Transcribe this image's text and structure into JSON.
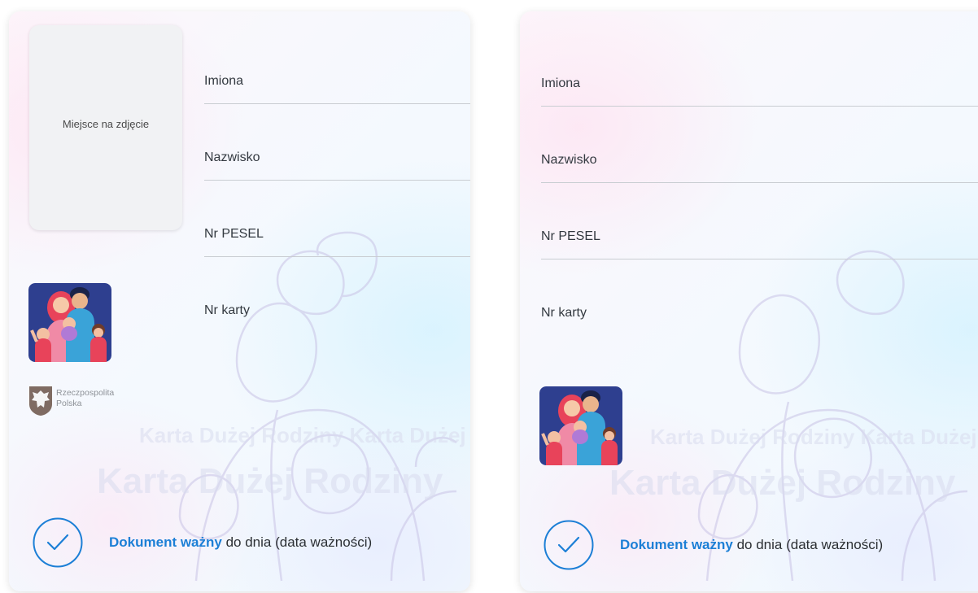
{
  "colors": {
    "accent": "#1c7fd6",
    "field_line": "#c9cdd2",
    "photo_bg": "#f1f2f4"
  },
  "card_left": {
    "photo_placeholder": "Miejsce na zdjęcie",
    "fields": [
      {
        "label": "Imiona"
      },
      {
        "label": "Nazwisko"
      },
      {
        "label": "Nr PESEL"
      },
      {
        "label": "Nr karty"
      }
    ],
    "emblem": {
      "line1": "Rzeczpospolita",
      "line2": "Polska"
    },
    "watermark": {
      "line1": "Karta Dużej Rodziny Karta Dużej",
      "line2": "Karta Dużej Rodziny"
    },
    "validity": {
      "strong": "Dokument ważny",
      "rest": "do dnia (data ważności)",
      "icon": "check-circle-icon"
    }
  },
  "card_right": {
    "fields": [
      {
        "label": "Imiona"
      },
      {
        "label": "Nazwisko"
      },
      {
        "label": "Nr PESEL"
      },
      {
        "label": "Nr karty"
      }
    ],
    "watermark": {
      "line1": "Karta Dużej Rodziny Karta Dużej",
      "line2": "Karta Dużej Rodziny"
    },
    "validity": {
      "strong": "Dokument ważny",
      "rest": "do dnia (data ważności)",
      "icon": "check-circle-icon"
    }
  }
}
